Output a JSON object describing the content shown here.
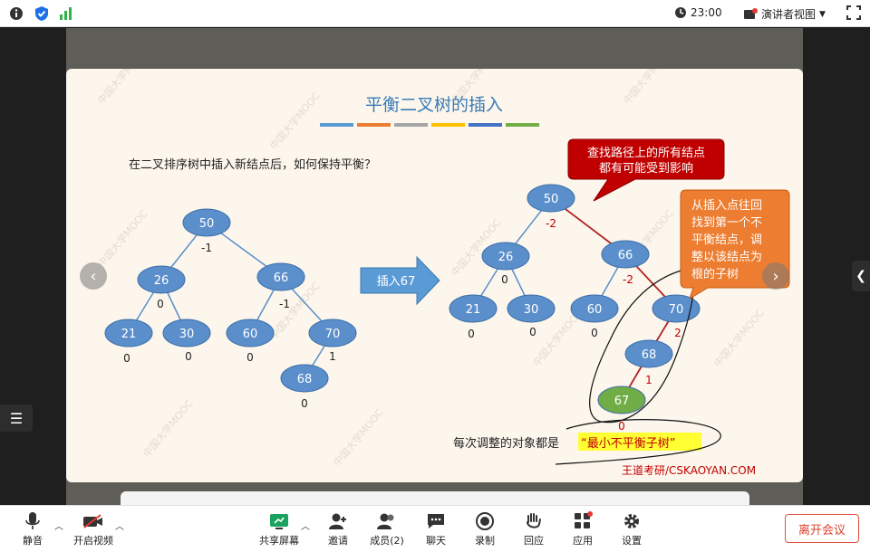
{
  "topbar": {
    "time": "23:00",
    "view_label": "演讲者视图",
    "icons": [
      "info-icon",
      "shield-check-icon",
      "signal-icon",
      "clock-icon",
      "presenter-view-icon",
      "fullscreen-icon"
    ]
  },
  "slide": {
    "title": "平衡二叉树的插入",
    "title_bar_colors": [
      "#5b9bd5",
      "#ed7d31",
      "#a5a5a5",
      "#ffc000",
      "#4472c4",
      "#70ad47"
    ],
    "question": "在二叉排序树中插入新结点后，如何保持平衡？",
    "insert_label": "插入67",
    "callout_red": [
      "查找路径上的所有结点",
      "都有可能受到影响"
    ],
    "callout_orange": [
      "从插入点往回",
      "找到第一个不",
      "平衡结点，调",
      "整以该结点为",
      "根的子树"
    ],
    "bottom_text_prefix": "每次调整的对象都是",
    "bottom_text_highlight": "“最小不平衡子树”",
    "credit": "王道考研/CSKAOYAN.COM",
    "watermark": "中国大学MOOC",
    "left_tree": {
      "nodes": [
        "50",
        "26",
        "66",
        "21",
        "30",
        "60",
        "70",
        "68"
      ],
      "balances": [
        "-1",
        "0",
        "-1",
        "0",
        "0",
        "0",
        "1",
        "0"
      ]
    },
    "right_tree": {
      "nodes": [
        "50",
        "26",
        "66",
        "21",
        "30",
        "60",
        "70",
        "68",
        "67"
      ],
      "balances": [
        "-2",
        "0",
        "-2",
        "0",
        "0",
        "0",
        "2",
        "1",
        "0"
      ]
    },
    "colors": {
      "node": "#5b8fcb",
      "new_node": "#70ad47",
      "path": "#b22222",
      "highlight": "#ffff33",
      "callout_red": "#c00000",
      "callout_orange": "#ed7d31"
    }
  },
  "bottombar": {
    "mute": "静音",
    "video": "开启视频",
    "share": "共享屏幕",
    "invite": "邀请",
    "members": "成员(2)",
    "chat": "聊天",
    "record": "录制",
    "reactions": "回应",
    "apps": "应用",
    "settings": "设置",
    "leave": "离开会议"
  }
}
